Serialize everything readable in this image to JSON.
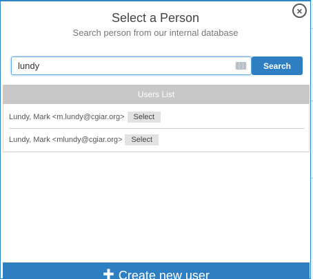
{
  "modal": {
    "title": "Select a Person",
    "subtitle": "Search person from our internal database"
  },
  "search": {
    "value": "lundy",
    "button_label": "Search"
  },
  "users_list": {
    "header": "Users List",
    "rows": [
      {
        "name": "Lundy, Mark <m.lundy@cgiar.org>",
        "select_label": "Select"
      },
      {
        "name": "Lundy, Mark <mlundy@cgiar.org>",
        "select_label": "Select"
      }
    ]
  },
  "create_user": {
    "label": "Create new user"
  },
  "icons": {
    "close": "close-circle-icon",
    "plus": "plus-icon",
    "input_badge": "autofill-badge-icon"
  },
  "colors": {
    "accent": "#2e7fc1",
    "header_gray": "#c8c8c8"
  }
}
